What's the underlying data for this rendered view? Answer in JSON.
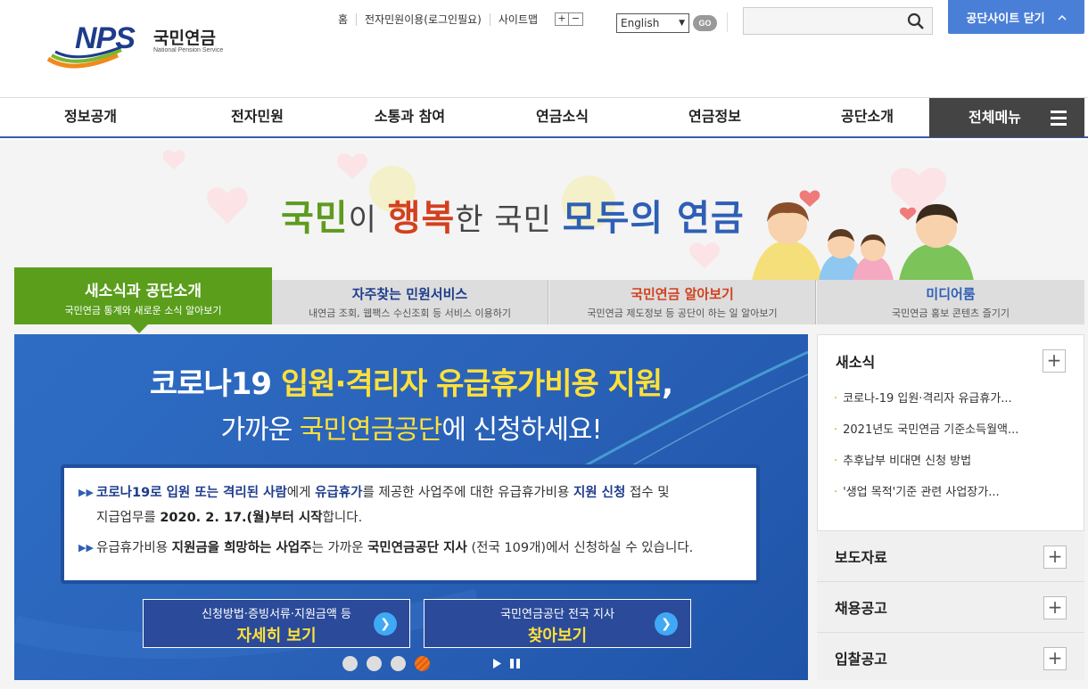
{
  "logo": {
    "abbr": "NPS",
    "name_kr": "국민연금",
    "name_en": "National Pension Service"
  },
  "util_links": [
    "홈",
    "전자민원이용(로그인필요)",
    "사이트맵"
  ],
  "zoom": {
    "plus": "+",
    "minus": "−"
  },
  "language": {
    "selected": "English",
    "go": "GO"
  },
  "search": {
    "placeholder": ""
  },
  "close_site": {
    "label": "공단사이트 닫기",
    "icon": "chevron-up-icon"
  },
  "gnb": {
    "items": [
      "정보공개",
      "전자민원",
      "소통과 참여",
      "연금소식",
      "연금정보",
      "공단소개"
    ],
    "all_menu": "전체메뉴"
  },
  "slogan": {
    "p1": "국민",
    "p2": "이 ",
    "p3": "행복",
    "p4": "한 국민 ",
    "p5": "모두의 연금"
  },
  "tabs": [
    {
      "title": "새소식과 공단소개",
      "sub": "국민연금 통계와 새로운 소식 알아보기"
    },
    {
      "title": "자주찾는 민원서비스",
      "sub": "내연금 조회, 웹팩스 수신조회 등 서비스 이용하기"
    },
    {
      "title": "국민연금 알아보기",
      "sub": "국민연금 제도정보 등 공단이 하는 일 알아보기"
    },
    {
      "title": "미디어룸",
      "sub": "국민연금 홍보 콘텐츠 즐기기"
    }
  ],
  "banner": {
    "h1_a": "코로나19 ",
    "h1_b": "입원·격리자 유급휴가비용 지원",
    "h1_c": ",",
    "h2_a": "가까운 ",
    "h2_b": "국민연금공단",
    "h2_c": "에 신청하세요!",
    "p1_a": "코로나19로 입원 또는 격리된 사람",
    "p1_b": "에게 ",
    "p1_c": "유급휴가",
    "p1_d": "를 제공한 사업주에 대한 유급휴가비용 ",
    "p1_e": "지원 신청",
    "p1_f": " 접수 및",
    "p1_g": "지급업무를 ",
    "p1_h": "2020. 2. 17.(월)부터 시작",
    "p1_i": "합니다.",
    "p2_a": "유급휴가비용 ",
    "p2_b": "지원금을 희망하는 사업주",
    "p2_c": "는 가까운 ",
    "p2_d": "국민연금공단 지사",
    "p2_e": " (전국 109개)에서 신청하실 수 있습니다.",
    "btn1_small": "신청방법·증빙서류·지원금액 등",
    "btn1_large": "자세히 보기",
    "btn2_small": "국민연금공단 전국 지사",
    "btn2_large": "찾아보기",
    "slides_total": 4,
    "slide_current": 4
  },
  "side": {
    "news_title": "새소식",
    "news_items": [
      "코로나-19 입원·격리자 유급휴가...",
      "2021년도 국민연금 기준소득월액...",
      "추후납부 비대면 신청 방법",
      "'생업 목적'기준 관련 사업장가..."
    ],
    "sections": [
      "보도자료",
      "채용공고",
      "입찰공고"
    ],
    "plus": "+"
  },
  "colors": {
    "brand_blue": "#1e3c8c",
    "green": "#5a9e1c",
    "orange": "#d2411e",
    "banner_blue": "#2a62b8",
    "accent_yellow": "#ffe03a"
  }
}
